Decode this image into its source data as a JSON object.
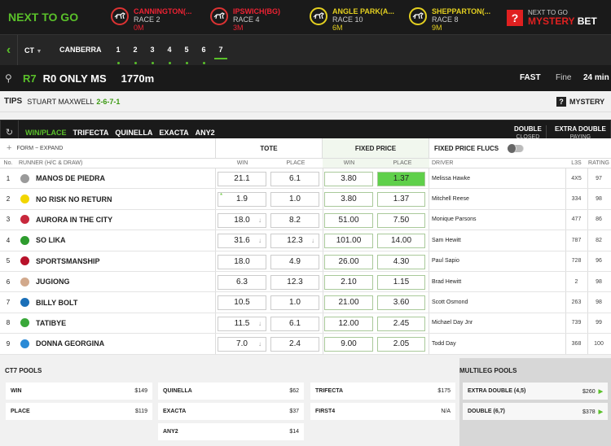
{
  "next_to_go": {
    "title": "NEXT TO GO",
    "races": [
      {
        "name": "CANNINGTON(...",
        "race": "RACE 2",
        "time": "0M",
        "color": "red"
      },
      {
        "name": "IPSWICH(BG)",
        "race": "RACE 4",
        "time": "3M",
        "color": "red"
      },
      {
        "name": "ANGLE PARK(A...",
        "race": "RACE 10",
        "time": "6M",
        "color": "yellow"
      },
      {
        "name": "SHEPPARTON(...",
        "race": "RACE 8",
        "time": "9M",
        "color": "yellow"
      }
    ],
    "mystery_bet": {
      "line1": "NEXT TO GO",
      "line2_a": "MYSTERY",
      "line2_b": "BET",
      "icon": "?"
    }
  },
  "nav": {
    "back_icon": "chevron-left-icon",
    "state": "CT",
    "venue": "CANBERRA",
    "races": [
      "1",
      "2",
      "3",
      "4",
      "5",
      "6",
      "7"
    ],
    "active_race": "7"
  },
  "race": {
    "icon": "greyhound-icon",
    "number": "R7",
    "name": "R0 ONLY MS",
    "distance": "1770m",
    "condition": "FAST",
    "track": "Fine",
    "time": "24 min"
  },
  "tips": {
    "label": "TIPS",
    "tipster": "STUART MAXWELL",
    "selection": "2-6-7-1",
    "mystery_label": "MYSTERY",
    "mystery_icon": "?"
  },
  "bet_types": {
    "tabs": [
      "WIN/PLACE",
      "TRIFECTA",
      "QUINELLA",
      "EXACTA",
      "ANY2"
    ],
    "active": "WIN/PLACE",
    "double": {
      "label": "DOUBLE",
      "status": "CLOSED"
    },
    "extra_double": {
      "label": "EXTRA DOUBLE",
      "status": "PAYING"
    }
  },
  "table": {
    "form_label": "FORM − EXPAND",
    "tote_label": "TOTE",
    "fixed_label": "FIXED PRICE",
    "flucs_label": "FIXED PRICE FLUCS",
    "cols": {
      "no": "No.",
      "runner": "RUNNER (H/C & DRAW)",
      "win": "WIN",
      "place": "PLACE",
      "driver": "DRIVER",
      "l3s": "L3S",
      "rating": "RATING"
    },
    "rows": [
      {
        "no": "1",
        "name": "MANOS DE PIEDRA",
        "tote_win": "21.1",
        "tote_place": "6.1",
        "fp_win": "3.80",
        "fp_place": "1.37",
        "driver": "Melissa Hawke",
        "l3s": "4X5",
        "rating": "97",
        "silk": "#9a9a9a",
        "win_arrow": "",
        "place_arrow": "",
        "fp_place_hl": true,
        "star": ""
      },
      {
        "no": "2",
        "name": "NO RISK NO RETURN",
        "tote_win": "1.9",
        "tote_place": "1.0",
        "fp_win": "3.80",
        "fp_place": "1.37",
        "driver": "Mitchell Reese",
        "l3s": "334",
        "rating": "98",
        "silk": "#f2d600",
        "win_arrow": "",
        "place_arrow": "",
        "fp_place_hl": false,
        "star": "*"
      },
      {
        "no": "3",
        "name": "AURORA IN THE CITY",
        "tote_win": "18.0",
        "tote_place": "8.2",
        "fp_win": "51.00",
        "fp_place": "7.50",
        "driver": "Monique Parsons",
        "l3s": "477",
        "rating": "86",
        "silk": "#c8283c",
        "win_arrow": "↓",
        "place_arrow": "",
        "fp_place_hl": false,
        "star": ""
      },
      {
        "no": "4",
        "name": "SO LIKA",
        "tote_win": "31.6",
        "tote_place": "12.3",
        "fp_win": "101.00",
        "fp_place": "14.00",
        "driver": "Sam Hewitt",
        "l3s": "787",
        "rating": "82",
        "silk": "#2e9c2e",
        "win_arrow": "↓",
        "place_arrow": "↓",
        "fp_place_hl": false,
        "star": ""
      },
      {
        "no": "5",
        "name": "SPORTSMANSHIP",
        "tote_win": "18.0",
        "tote_place": "4.9",
        "fp_win": "26.00",
        "fp_place": "4.30",
        "driver": "Paul Sapio",
        "l3s": "728",
        "rating": "96",
        "silk": "#b8122a",
        "win_arrow": "",
        "place_arrow": "",
        "fp_place_hl": false,
        "star": ""
      },
      {
        "no": "6",
        "name": "JUGIONG",
        "tote_win": "6.3",
        "tote_place": "12.3",
        "fp_win": "2.10",
        "fp_place": "1.15",
        "driver": "Brad Hewitt",
        "l3s": "2",
        "rating": "98",
        "silk": "#d2a98c",
        "win_arrow": "",
        "place_arrow": "",
        "fp_place_hl": false,
        "star": ""
      },
      {
        "no": "7",
        "name": "BILLY BOLT",
        "tote_win": "10.5",
        "tote_place": "1.0",
        "fp_win": "21.00",
        "fp_place": "3.60",
        "driver": "Scott Osmond",
        "l3s": "263",
        "rating": "98",
        "silk": "#1a6fb8",
        "win_arrow": "",
        "place_arrow": "",
        "fp_place_hl": false,
        "star": ""
      },
      {
        "no": "8",
        "name": "TATIBYE",
        "tote_win": "11.5",
        "tote_place": "6.1",
        "fp_win": "12.00",
        "fp_place": "2.45",
        "driver": "Michael Day Jnr",
        "l3s": "739",
        "rating": "99",
        "silk": "#3aa83a",
        "win_arrow": "↓",
        "place_arrow": "",
        "fp_place_hl": false,
        "star": ""
      },
      {
        "no": "9",
        "name": "DONNA GEORGINA",
        "tote_win": "7.0",
        "tote_place": "2.4",
        "fp_win": "9.00",
        "fp_place": "2.05",
        "driver": "Todd Day",
        "l3s": "368",
        "rating": "100",
        "silk": "#2a8ad6",
        "win_arrow": "↓",
        "place_arrow": "",
        "fp_place_hl": false,
        "star": ""
      }
    ]
  },
  "pools": {
    "title": "CT7 POOLS",
    "items": [
      {
        "name": "WIN",
        "value": "$149"
      },
      {
        "name": "PLACE",
        "value": "$119"
      },
      {
        "name": "QUINELLA",
        "value": "$62"
      },
      {
        "name": "EXACTA",
        "value": "$37"
      },
      {
        "name": "ANY2",
        "value": "$14"
      },
      {
        "name": "TRIFECTA",
        "value": "$175"
      },
      {
        "name": "FIRST4",
        "value": "N/A"
      }
    ],
    "multileg_title": "MULTILEG POOLS",
    "multileg": [
      {
        "name": "EXTRA DOUBLE (4,5)",
        "value": "$260"
      },
      {
        "name": "DOUBLE (6,7)",
        "value": "$378"
      }
    ]
  }
}
